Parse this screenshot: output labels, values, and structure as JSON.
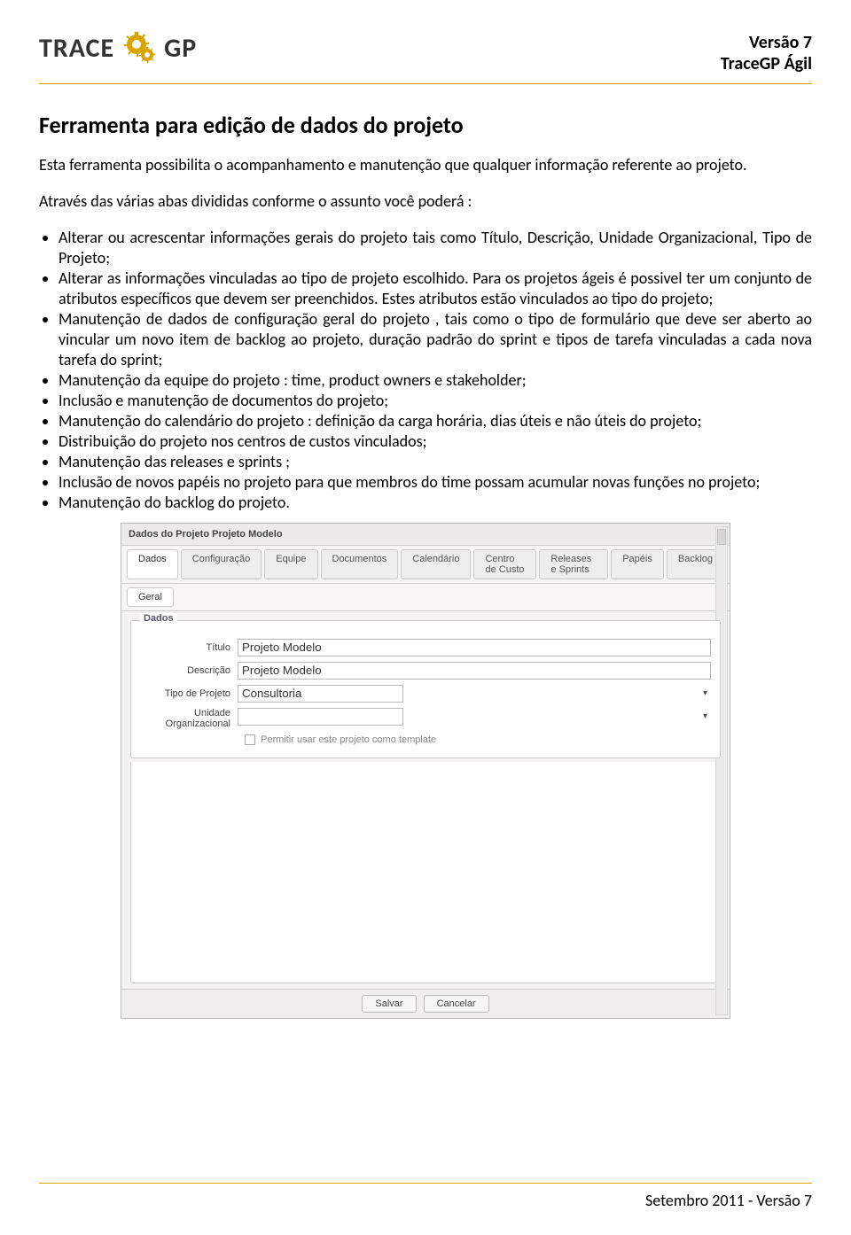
{
  "header": {
    "logo_text_a": "TRACE",
    "logo_text_b": "GP",
    "version_line": "Versão 7",
    "product_line": "TraceGP Ágil"
  },
  "title": "Ferramenta para edição de dados do projeto",
  "intro": "Esta ferramenta possibilita o acompanhamento e manutenção que qualquer informação referente ao projeto.",
  "lead": "Através das várias abas divididas conforme o assunto você poderá :",
  "bullets": [
    "Alterar ou acrescentar informações gerais do projeto tais como Título, Descrição, Unidade Organizacional, Tipo de Projeto;",
    "Alterar as informações vinculadas ao tipo de projeto escolhido. Para os projetos ágeis é possivel ter um conjunto de atributos específicos que devem ser preenchidos. Estes atributos estão vinculados ao tipo do projeto;",
    "Manutenção de dados de configuração geral do projeto , tais como o tipo de formulário que deve ser aberto ao vincular um novo item de backlog ao projeto, duração padrão do sprint e tipos de tarefa vinculadas a cada nova tarefa do sprint;",
    "Manutenção da equipe do projeto : time, product owners e stakeholder;",
    "Inclusão e manutenção de documentos do projeto;",
    "Manutenção do calendário do projeto : definição da carga horária, dias úteis e não úteis do projeto;",
    "Distribuição do projeto nos centros de custos vinculados;",
    "Manutenção das releases e sprints ;",
    "Inclusão de novos papéis no projeto para que membros do time possam acumular novas funções no projeto;",
    "Manutenção do backlog do projeto."
  ],
  "app": {
    "title": "Dados do Projeto Projeto Modelo",
    "tabs": [
      "Dados",
      "Configuração",
      "Equipe",
      "Documentos",
      "Calendário",
      "Centro de Custo",
      "Releases e Sprints",
      "Papéis",
      "Backlog"
    ],
    "active_tab_index": 0,
    "subtabs": [
      "Geral"
    ],
    "active_subtab_index": 0,
    "fieldset_legend": "Dados",
    "fields": {
      "titulo_label": "Título",
      "titulo_value": "Projeto Modelo",
      "descricao_label": "Descrição",
      "descricao_value": "Projeto Modelo",
      "tipo_label": "Tipo de Projeto",
      "tipo_value": "Consultoria",
      "unidade_label_line1": "Unidade",
      "unidade_label_line2": "Organizacional",
      "unidade_value": "",
      "template_checkbox_label": "Permitir usar este projeto como template"
    },
    "buttons": {
      "save": "Salvar",
      "cancel": "Cancelar"
    }
  },
  "footer": "Setembro 2011 - Versão 7"
}
